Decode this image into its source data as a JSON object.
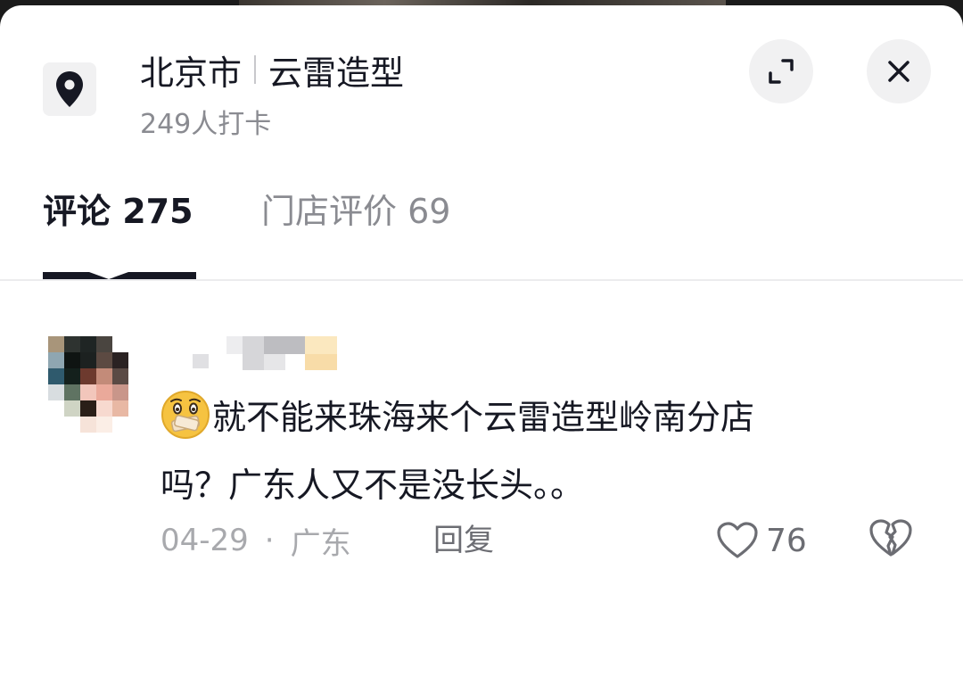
{
  "header": {
    "icon": "location-pin-icon",
    "city": "北京市",
    "shop_name": "云雷造型",
    "checkins": "249人打卡",
    "expand_icon": "expand-icon",
    "close_icon": "close-icon"
  },
  "tabs": [
    {
      "label": "评论 275",
      "active": true
    },
    {
      "label": "门店评价 69",
      "active": false
    }
  ],
  "comment": {
    "emoji": "hand-over-mouth-emoji",
    "text_line1": "就不能来珠海来个云雷造型岭南分店",
    "text_line2": "吗？广东人又不是没长头。。",
    "date": "04-29",
    "separator": "·",
    "location": "广东",
    "reply_label": "回复",
    "like_icon": "heart-icon",
    "likes": "76",
    "dislike_icon": "broken-heart-icon"
  },
  "colors": {
    "text_primary": "#161823",
    "text_secondary": "#8a8b91",
    "meta": "#a8a9ad",
    "button_bg": "#f1f1f2"
  }
}
